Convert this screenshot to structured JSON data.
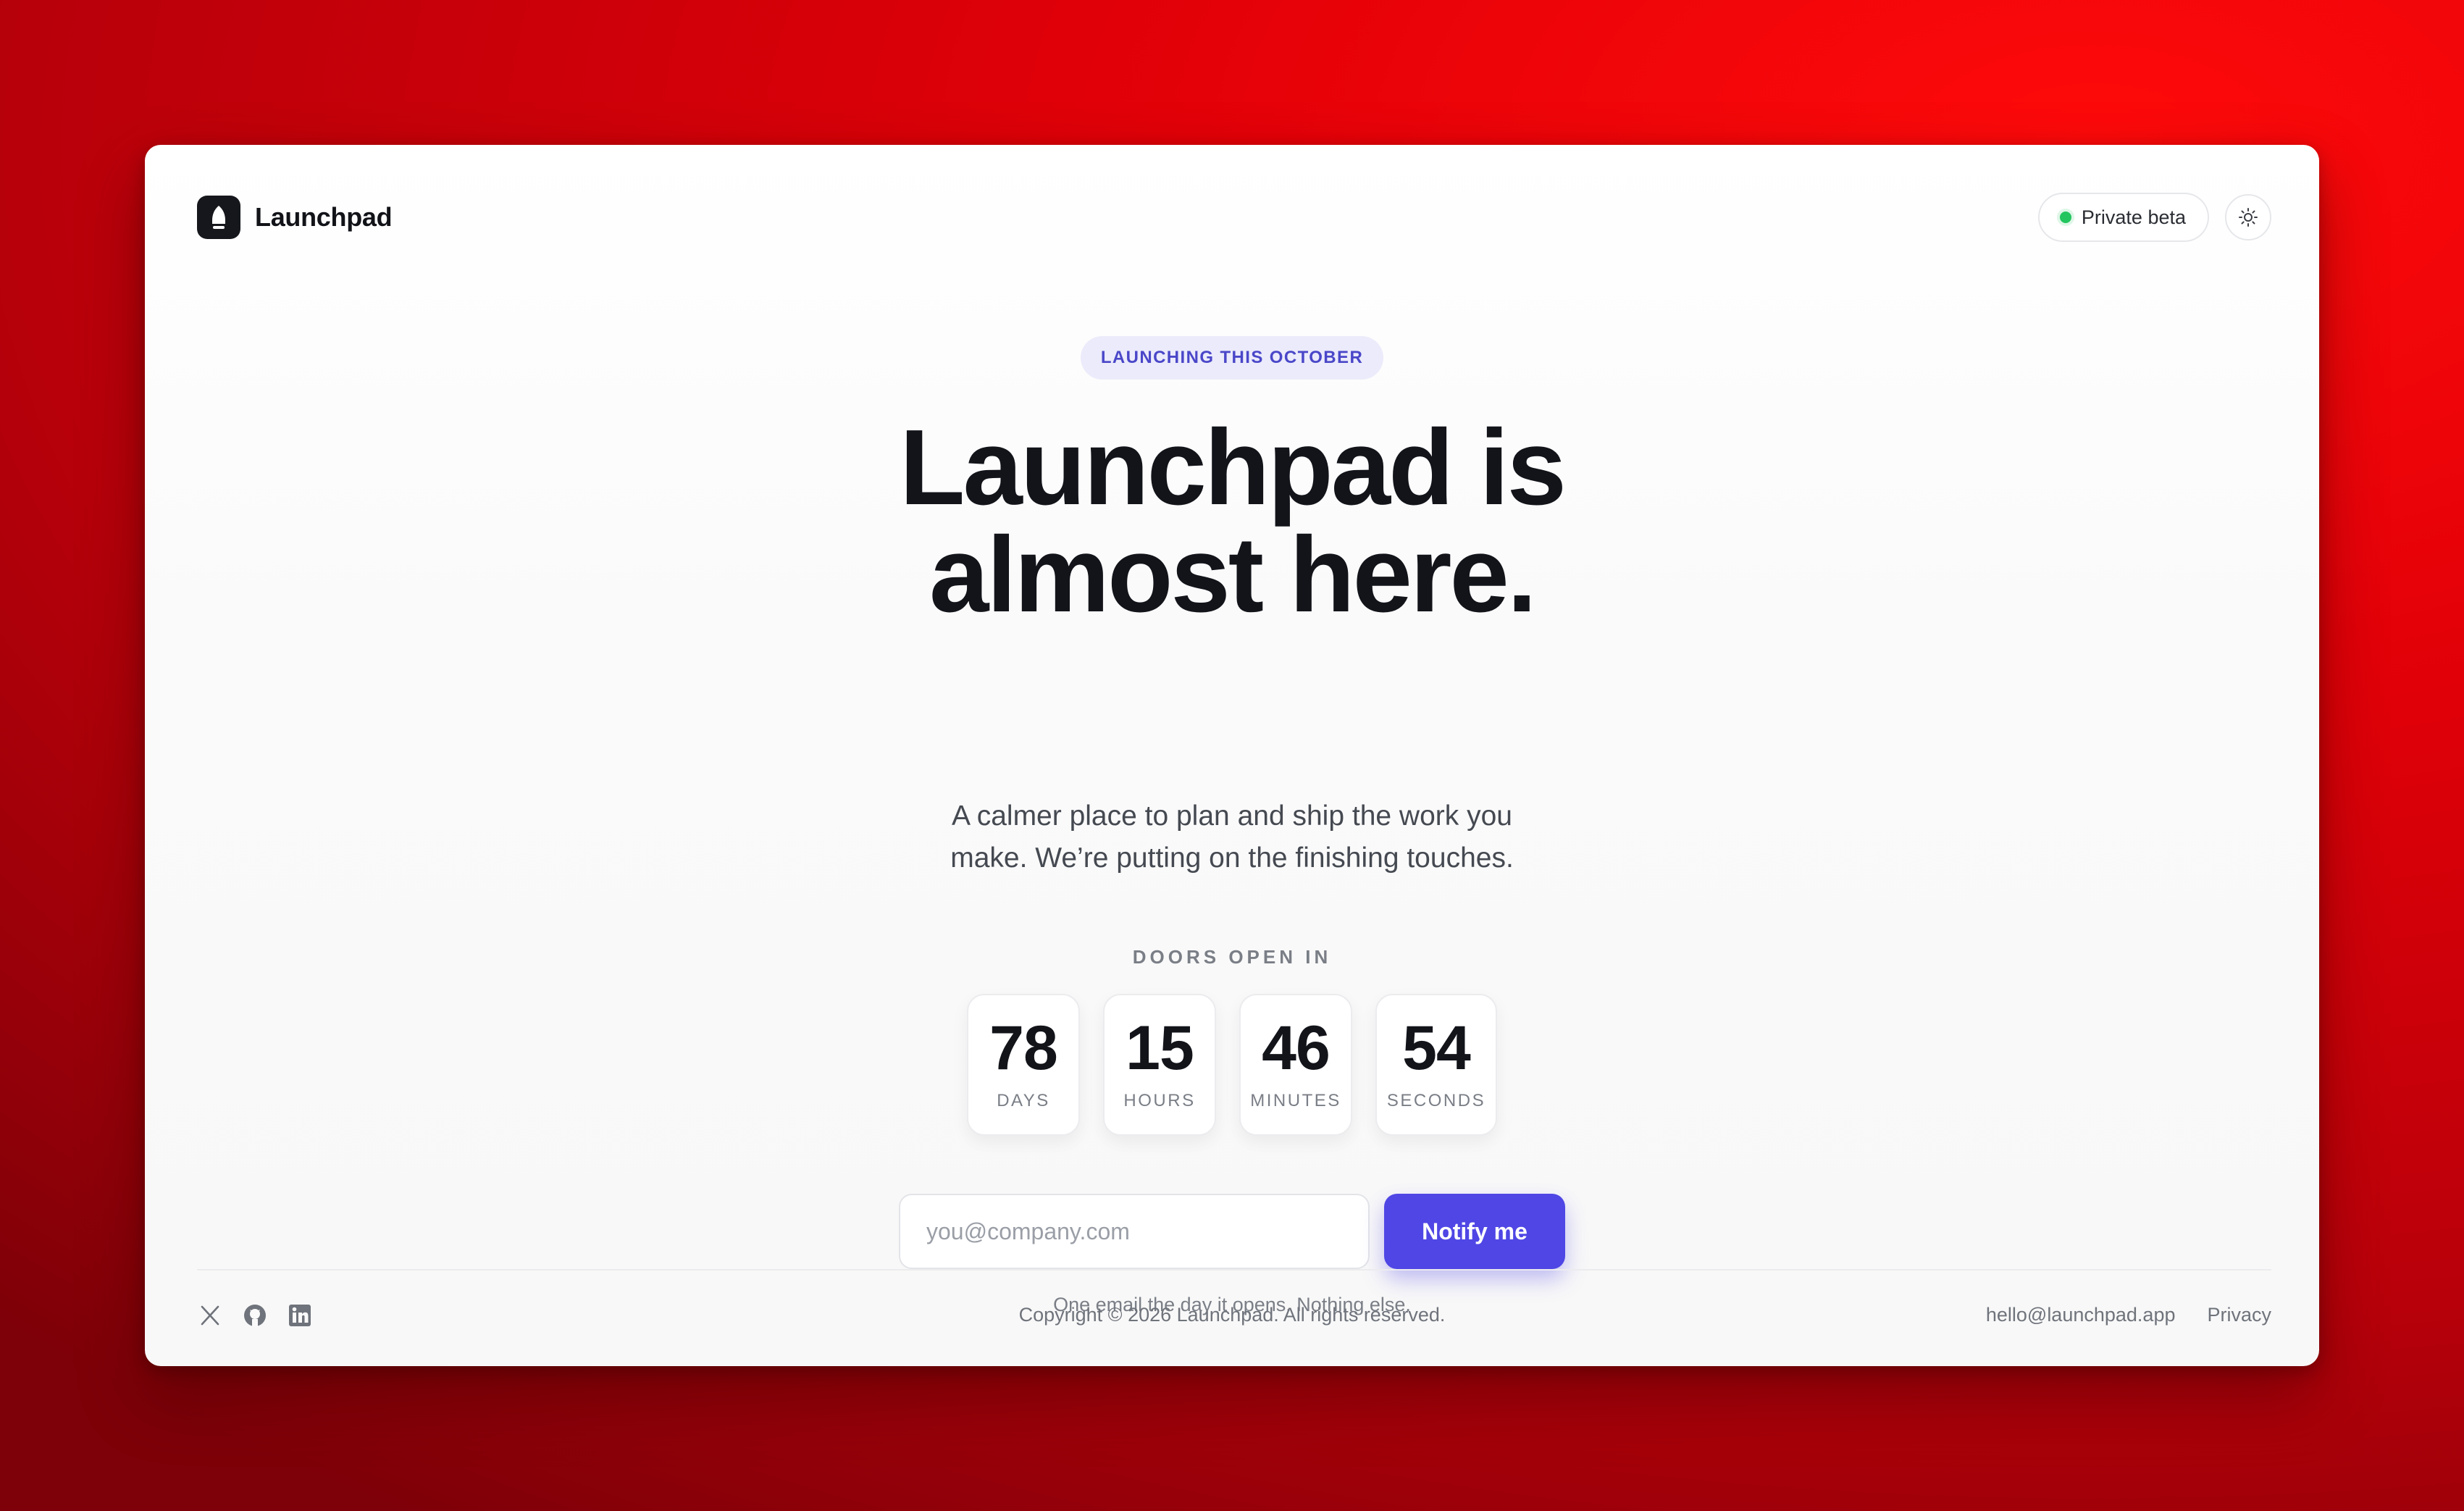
{
  "brand": {
    "name": "Launchpad",
    "logo_icon": "rocket-icon"
  },
  "header": {
    "beta_label": "Private beta",
    "status_color": "#22c55e",
    "theme_icon": "sun-icon"
  },
  "hero": {
    "eyebrow": "LAUNCHING THIS OCTOBER",
    "title_line1": "Launchpad is",
    "title_line2": "almost here.",
    "subtitle": "A calmer place to plan and ship the work you make. We’re putting on the finishing touches."
  },
  "countdown": {
    "heading": "DOORS OPEN IN",
    "units": [
      {
        "value": "78",
        "label": "DAYS"
      },
      {
        "value": "15",
        "label": "HOURS"
      },
      {
        "value": "46",
        "label": "MINUTES"
      },
      {
        "value": "54",
        "label": "SECONDS"
      }
    ]
  },
  "signup": {
    "email_placeholder": "you@company.com",
    "email_value": "",
    "button_label": "Notify me",
    "note": "One email the day it opens. Nothing else.",
    "accent_color": "#4f46e5"
  },
  "footer": {
    "social_icons": [
      "x-icon",
      "github-icon",
      "linkedin-icon"
    ],
    "copyright": "Copyright © 2026 Launchpad. All rights reserved.",
    "email_link": "hello@launchpad.app",
    "privacy_link": "Privacy"
  }
}
